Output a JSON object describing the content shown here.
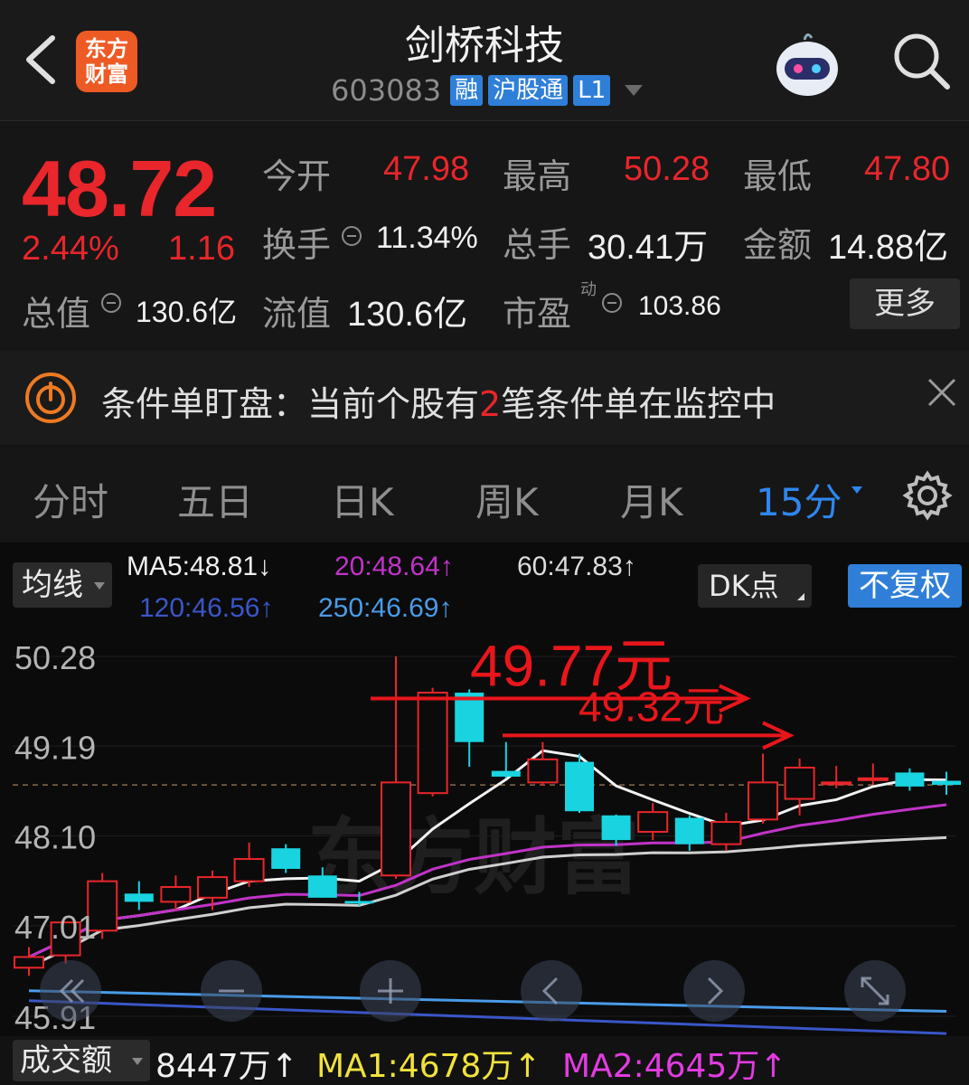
{
  "header": {
    "title": "剑桥科技",
    "code": "603083",
    "tags": [
      "融",
      "沪股通",
      "L1"
    ],
    "logo_text_line1": "东方",
    "logo_text_line2": "财富"
  },
  "quote": {
    "price": "48.72",
    "pct_change": "2.44%",
    "change": "1.16",
    "open_label": "今开",
    "open_value": "47.98",
    "high_label": "最高",
    "high_value": "50.28",
    "low_label": "最低",
    "low_value": "47.80",
    "turnover_label": "换手",
    "turnover_value": "11.34%",
    "volume_label": "总手",
    "volume_value": "30.41万",
    "amount_label": "金额",
    "amount_value": "14.88亿",
    "mktcap_label": "总值",
    "mktcap_value": "130.6亿",
    "float_label": "流值",
    "float_value": "130.6亿",
    "pe_label": "市盈",
    "pe_sup": "动",
    "pe_value": "103.86",
    "more_label": "更多"
  },
  "banner": {
    "prefix": "条件单盯盘：当前个股有",
    "count": "2",
    "suffix": "笔条件单在监控中"
  },
  "tabs": [
    {
      "label": "分时",
      "active": false
    },
    {
      "label": "五日",
      "active": false
    },
    {
      "label": "日K",
      "active": false
    },
    {
      "label": "周K",
      "active": false
    },
    {
      "label": "月K",
      "active": false
    },
    {
      "label": "15分",
      "active": true
    }
  ],
  "indicators": {
    "ma_selector": "均线",
    "ma5": "MA5:48.81↓",
    "ma20": "20:48.64↑",
    "ma60": "60:47.83↑",
    "ma120": "120:46.56↑",
    "ma250": "250:46.69↑",
    "dk_button": "DK点",
    "adjust_button": "不复权"
  },
  "colors": {
    "up": "#e8262b",
    "down": "#19d3e0",
    "ma5": "#f2f2f2",
    "ma20": "#c133c8",
    "ma60": "#cfcfcf",
    "ma120": "#3a56c8",
    "ma250": "#4a9be8",
    "accent": "#2f86ee"
  },
  "chart_data": {
    "type": "candlestick",
    "yticks": [
      "50.28",
      "49.19",
      "48.10",
      "47.01",
      "45.91"
    ],
    "ylim": [
      45.91,
      50.28
    ],
    "current_price": 48.72,
    "annotations": [
      {
        "text": "49.77元",
        "price": 49.77
      },
      {
        "text": "49.32元",
        "price": 49.32
      }
    ],
    "watermark": "东方财富",
    "candles": [
      {
        "o": 46.5,
        "c": 46.63,
        "h": 46.75,
        "l": 46.4
      },
      {
        "o": 46.65,
        "c": 47.05,
        "h": 47.05,
        "l": 46.55
      },
      {
        "o": 46.95,
        "c": 47.55,
        "h": 47.65,
        "l": 46.85
      },
      {
        "o": 47.4,
        "c": 47.3,
        "h": 47.55,
        "l": 47.2
      },
      {
        "o": 47.3,
        "c": 47.48,
        "h": 47.62,
        "l": 47.2
      },
      {
        "o": 47.35,
        "c": 47.6,
        "h": 47.68,
        "l": 47.2
      },
      {
        "o": 47.55,
        "c": 47.82,
        "h": 48.02,
        "l": 47.48
      },
      {
        "o": 47.95,
        "c": 47.7,
        "h": 48.0,
        "l": 47.65
      },
      {
        "o": 47.62,
        "c": 47.35,
        "h": 47.72,
        "l": 47.35
      },
      {
        "o": 47.31,
        "c": 47.28,
        "h": 47.42,
        "l": 47.25
      },
      {
        "o": 47.62,
        "c": 48.75,
        "h": 50.28,
        "l": 47.58
      },
      {
        "o": 48.62,
        "c": 49.84,
        "h": 49.9,
        "l": 48.58
      },
      {
        "o": 49.84,
        "c": 49.24,
        "h": 49.88,
        "l": 48.94
      },
      {
        "o": 48.89,
        "c": 48.82,
        "h": 49.24,
        "l": 48.8
      },
      {
        "o": 48.75,
        "c": 49.03,
        "h": 49.24,
        "l": 48.71
      },
      {
        "o": 49.0,
        "c": 48.4,
        "h": 49.1,
        "l": 48.38
      },
      {
        "o": 48.35,
        "c": 48.05,
        "h": 48.36,
        "l": 47.98
      },
      {
        "o": 48.15,
        "c": 48.39,
        "h": 48.5,
        "l": 48.05
      },
      {
        "o": 48.32,
        "c": 48.0,
        "h": 48.35,
        "l": 47.92
      },
      {
        "o": 48.0,
        "c": 48.27,
        "h": 48.38,
        "l": 47.92
      },
      {
        "o": 48.3,
        "c": 48.75,
        "h": 49.1,
        "l": 48.25
      },
      {
        "o": 48.55,
        "c": 48.93,
        "h": 49.04,
        "l": 48.35
      },
      {
        "o": 48.75,
        "c": 48.75,
        "h": 48.95,
        "l": 48.68
      },
      {
        "o": 48.8,
        "c": 48.8,
        "h": 48.98,
        "l": 48.72
      },
      {
        "o": 48.87,
        "c": 48.7,
        "h": 48.92,
        "l": 48.65
      },
      {
        "o": 48.77,
        "c": 48.72,
        "h": 48.88,
        "l": 48.6
      }
    ]
  },
  "volume": {
    "selector": "成交额",
    "value": "8447万↑",
    "ma1": "MA1:4678万↑",
    "ma2": "MA2:4645万↑"
  }
}
